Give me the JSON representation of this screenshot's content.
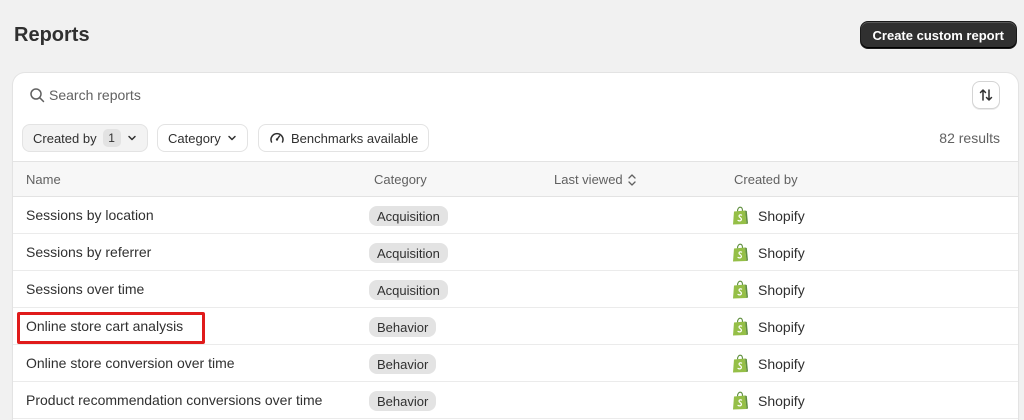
{
  "header": {
    "title": "Reports",
    "create_button_label": "Create custom report"
  },
  "search": {
    "placeholder": "Search reports",
    "value": ""
  },
  "filters": {
    "created_by_label": "Created by",
    "created_by_count": "1",
    "category_label": "Category",
    "benchmarks_label": "Benchmarks available",
    "results_count": "82 results"
  },
  "table": {
    "columns": {
      "name": "Name",
      "category": "Category",
      "last_viewed": "Last viewed",
      "created_by": "Created by"
    },
    "rows": [
      {
        "name": "Sessions by location",
        "category": "Acquisition",
        "created_by": "Shopify"
      },
      {
        "name": "Sessions by referrer",
        "category": "Acquisition",
        "created_by": "Shopify"
      },
      {
        "name": "Sessions over time",
        "category": "Acquisition",
        "created_by": "Shopify"
      },
      {
        "name": "Online store cart analysis",
        "category": "Behavior",
        "created_by": "Shopify"
      },
      {
        "name": "Online store conversion over time",
        "category": "Behavior",
        "created_by": "Shopify"
      },
      {
        "name": "Product recommendation conversions over time",
        "category": "Behavior",
        "created_by": "Shopify"
      }
    ]
  },
  "icons": {
    "search": "search-icon",
    "sort": "sort-icon",
    "chevron": "chevron-down-icon",
    "benchmark": "gauge-icon",
    "creator": "shopify-bag-icon"
  },
  "colors": {
    "primary_button": "#303030",
    "shopify_green": "#95bf47",
    "highlight": "#e01b1b",
    "badge_bg": "#e3e3e3"
  }
}
